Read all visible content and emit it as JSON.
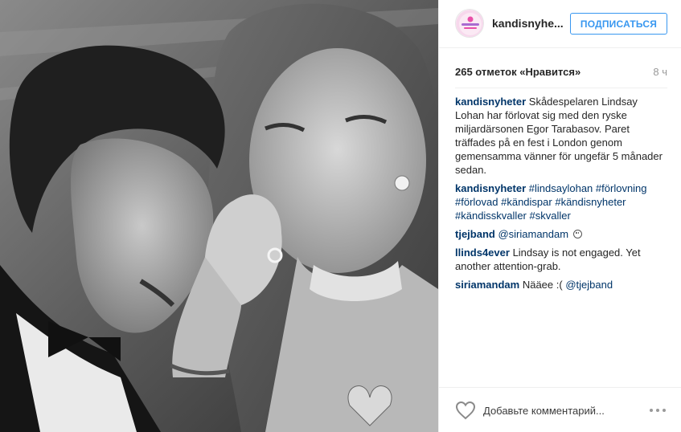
{
  "post": {
    "username": "kandisnyhe...",
    "follow_label": "ПОДПИСАТЬСЯ",
    "likes_text": "265 отметок «Нравится»",
    "time_ago": "8 ч"
  },
  "comments": [
    {
      "user": "kandisnyheter",
      "text": "Skådespelaren Lindsay Lohan har förlovat sig med den ryske miljardärsonen Egor Tarabasov. Paret träffades på en fest i London genom gemensamma vänner för ungefär 5 månader sedan."
    },
    {
      "user": "kandisnyheter",
      "hashtags": [
        "#lindsaylohan",
        "#förlovning",
        "#förlovad",
        "#kändispar",
        "#kändisnyheter",
        "#kändisskvaller",
        "#skvaller"
      ]
    },
    {
      "user": "tjejband",
      "mention": "@siriamandam"
    },
    {
      "user": "llinds4ever",
      "text": "Lindsay is not engaged. Yet another attention-grab."
    },
    {
      "user": "siriamandam",
      "text": "Nääee :(",
      "mention": "@tjejband"
    }
  ],
  "footer": {
    "comment_placeholder": "Добавьте комментарий...",
    "like_icon": "heart-outline-icon",
    "more_icon": "ellipsis-icon"
  },
  "colors": {
    "accent": "#3897f0",
    "link": "#003569",
    "muted": "#999999"
  }
}
